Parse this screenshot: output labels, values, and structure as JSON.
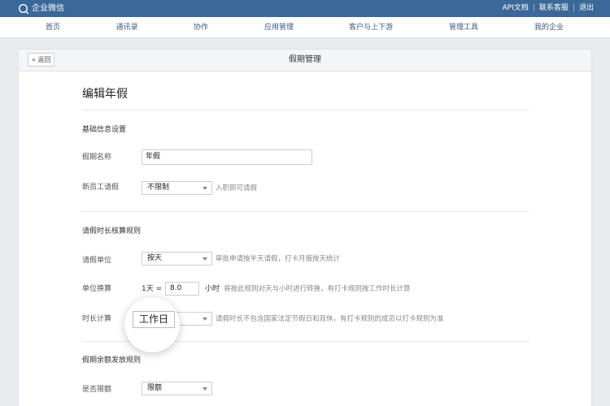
{
  "header": {
    "logo_text": "企业微信",
    "links": [
      "API文档",
      "联系客服",
      "退出"
    ]
  },
  "nav": {
    "items": [
      "首页",
      "通讯录",
      "协作",
      "应用管理",
      "客户与上下游",
      "管理工具",
      "我的企业"
    ]
  },
  "panel": {
    "back_label": "« 返回",
    "title": "假期管理"
  },
  "page": {
    "title": "编辑年假",
    "basic": {
      "section_title": "基础信息设置",
      "name_label": "假期名称",
      "name_value": "年假",
      "newbie_label": "新员工请假",
      "newbie_value": "不限制",
      "newbie_hint": "入职即可请假"
    },
    "duration": {
      "section_title": "请假时长核算规则",
      "unit_label": "请假单位",
      "unit_value": "按天",
      "unit_hint": "审批申请按半天请假，打卡月报按天统计",
      "conv_label": "单位换算",
      "conv_prefix": "1天 =",
      "conv_value": "8.0",
      "conv_unit": "小时",
      "conv_hint": "将按此规则对天与小时进行转换，有打卡规则按工作时长计算",
      "calc_label": "时长计算",
      "calc_value": "工作日",
      "calc_hint": "请假时长不包含国家法定节假日和双休，有打卡规则的成员以打卡规则为准"
    },
    "balance": {
      "section_title": "假期余额发放规则",
      "limit_label": "是否限额",
      "limit_value": "限额"
    }
  },
  "colors": {
    "topbar": "#3a6898",
    "nav_text": "#3b5a82",
    "background": "#e9ebee"
  }
}
